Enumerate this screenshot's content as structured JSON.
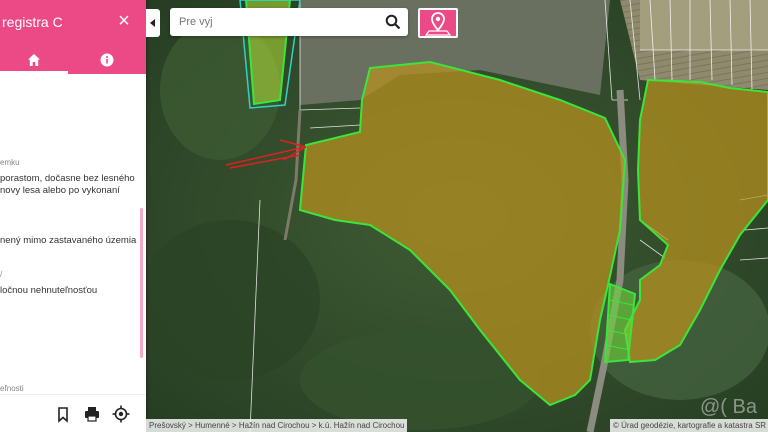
{
  "sidebar": {
    "title": "registra C",
    "close_icon": "×",
    "tabs": [
      {
        "icon": "home-icon"
      },
      {
        "icon": "info-icon"
      }
    ],
    "content": {
      "label_1": "emku",
      "text_1a": "porastom, dočasne bez lesného",
      "text_1b": "novy lesa alebo po vykonaní",
      "text_2": "nený mimo zastavaného územia",
      "label_2": "/",
      "text_3": "ločnou nehnuteľnosťou",
      "label_3": "eľnosti"
    },
    "footer": {
      "bookmark_icon": "bookmark-icon",
      "print_icon": "print-icon",
      "locate_icon": "crosshair-icon"
    }
  },
  "search": {
    "placeholder": "Pre vyj",
    "icon": "search-icon"
  },
  "location_button": {
    "icon": "map-pin-icon"
  },
  "breadcrumb": "Prešovský > Humenné > Hažín nad Cirochou > k.ú. Hažín nad Cirochou",
  "attribution": "© Úrad geodézie, kartografie a katastra SR ...",
  "watermark": "@( Ba",
  "colors": {
    "accent": "#ec4a86",
    "parcel_outline": "#39e639",
    "parcel_fill": "#b8921e"
  }
}
